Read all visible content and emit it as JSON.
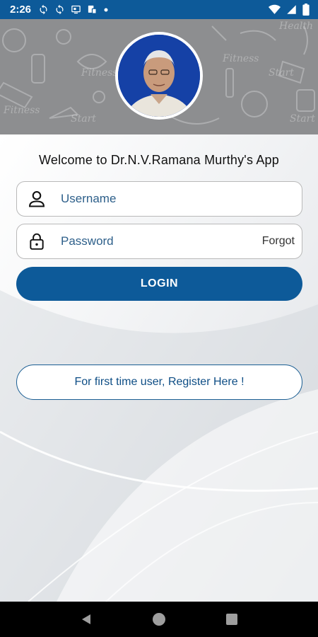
{
  "status_bar": {
    "time": "2:26",
    "icons": [
      "sync-icon",
      "sync-icon",
      "screen-cast-icon",
      "notification-icon",
      "dot-icon"
    ],
    "right_icons": [
      "wifi-icon",
      "signal-icon",
      "battery-icon"
    ]
  },
  "header": {
    "doodle_words": [
      "Fitness",
      "Start",
      "Health",
      "Fitness",
      "Start",
      "Fitness",
      "Start"
    ]
  },
  "login": {
    "welcome_text": "Welcome to Dr.N.V.Ramana Murthy's App",
    "username_placeholder": "Username",
    "password_placeholder": "Password",
    "forgot_label": "Forgot",
    "login_button_label": "LOGIN",
    "register_button_label": "For first time user, Register Here !"
  },
  "colors": {
    "primary": "#0d5a99",
    "header_bg": "#8d8e90",
    "field_text": "#2d5f8a"
  },
  "nav_bar": {
    "buttons": [
      "back-icon",
      "home-icon",
      "recents-icon"
    ]
  }
}
